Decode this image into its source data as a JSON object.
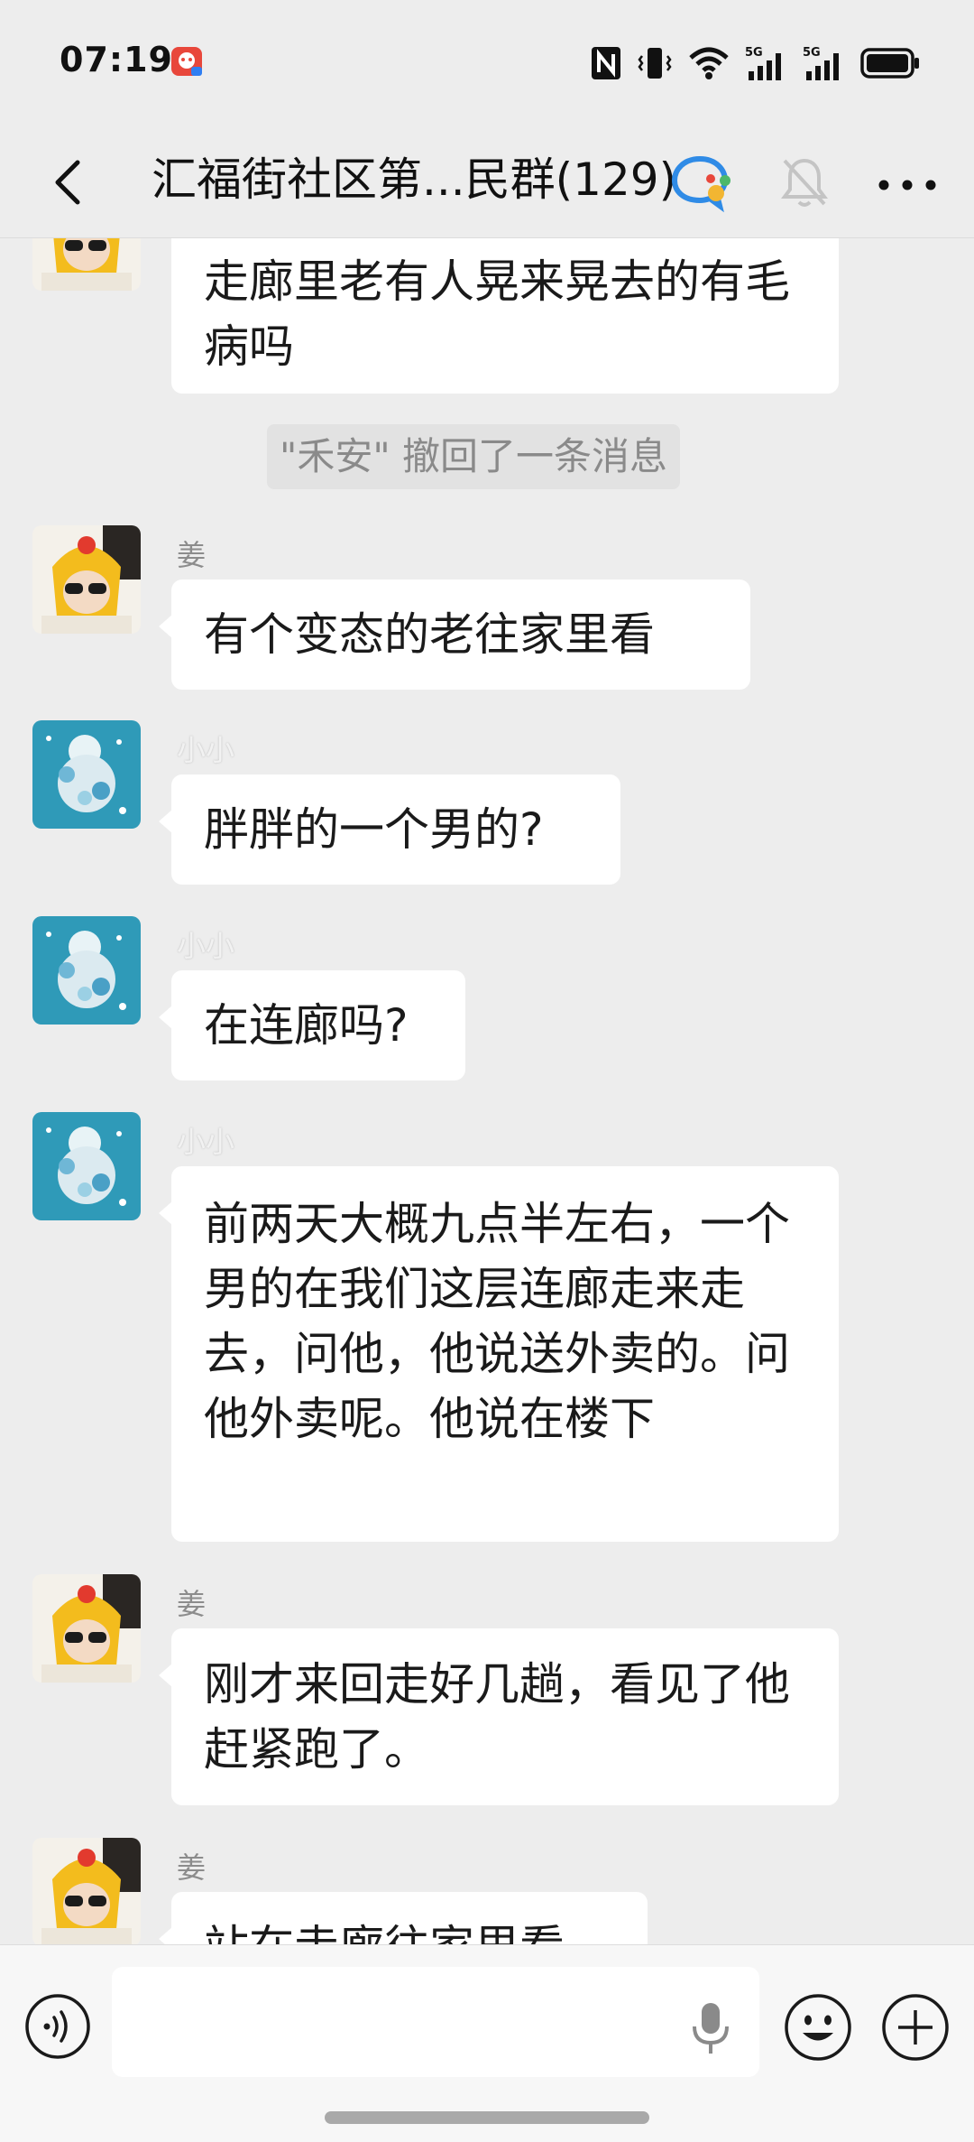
{
  "status_bar": {
    "time": "07:19"
  },
  "header": {
    "back_label": "<",
    "title": "汇福街社区第...民群(129)"
  },
  "messages": [
    {
      "sender": "",
      "avatar": "yellow-hat-avatar",
      "text": "走廊里老有人晃来晃去的有毛病吗"
    },
    {
      "system": "\"禾安\" 撤回了一条消息"
    },
    {
      "sender": "姜",
      "avatar": "yellow-hat-avatar",
      "text": "有个变态的老往家里看"
    },
    {
      "sender": "小小",
      "avatar": "blue-flower-avatar",
      "text": "胖胖的一个男的?"
    },
    {
      "sender": "小小",
      "avatar": "blue-flower-avatar",
      "text": "在连廊吗?"
    },
    {
      "sender": "小小",
      "avatar": "blue-flower-avatar",
      "text": "前两天大概九点半左右，一个男的在我们这层连廊走来走去，问他，他说送外卖的。问他外卖呢。他说在楼下"
    },
    {
      "sender": "姜",
      "avatar": "yellow-hat-avatar",
      "text": "刚才来回走好几趟，看见了他赶紧跑了。"
    },
    {
      "sender": "姜",
      "avatar": "yellow-hat-avatar",
      "text": "站在走廊往家里看"
    }
  ],
  "input": {
    "value": "",
    "placeholder": ""
  },
  "colors": {
    "background": "#ededed",
    "bubble": "#ffffff",
    "system_text": "#8a8a8a"
  }
}
